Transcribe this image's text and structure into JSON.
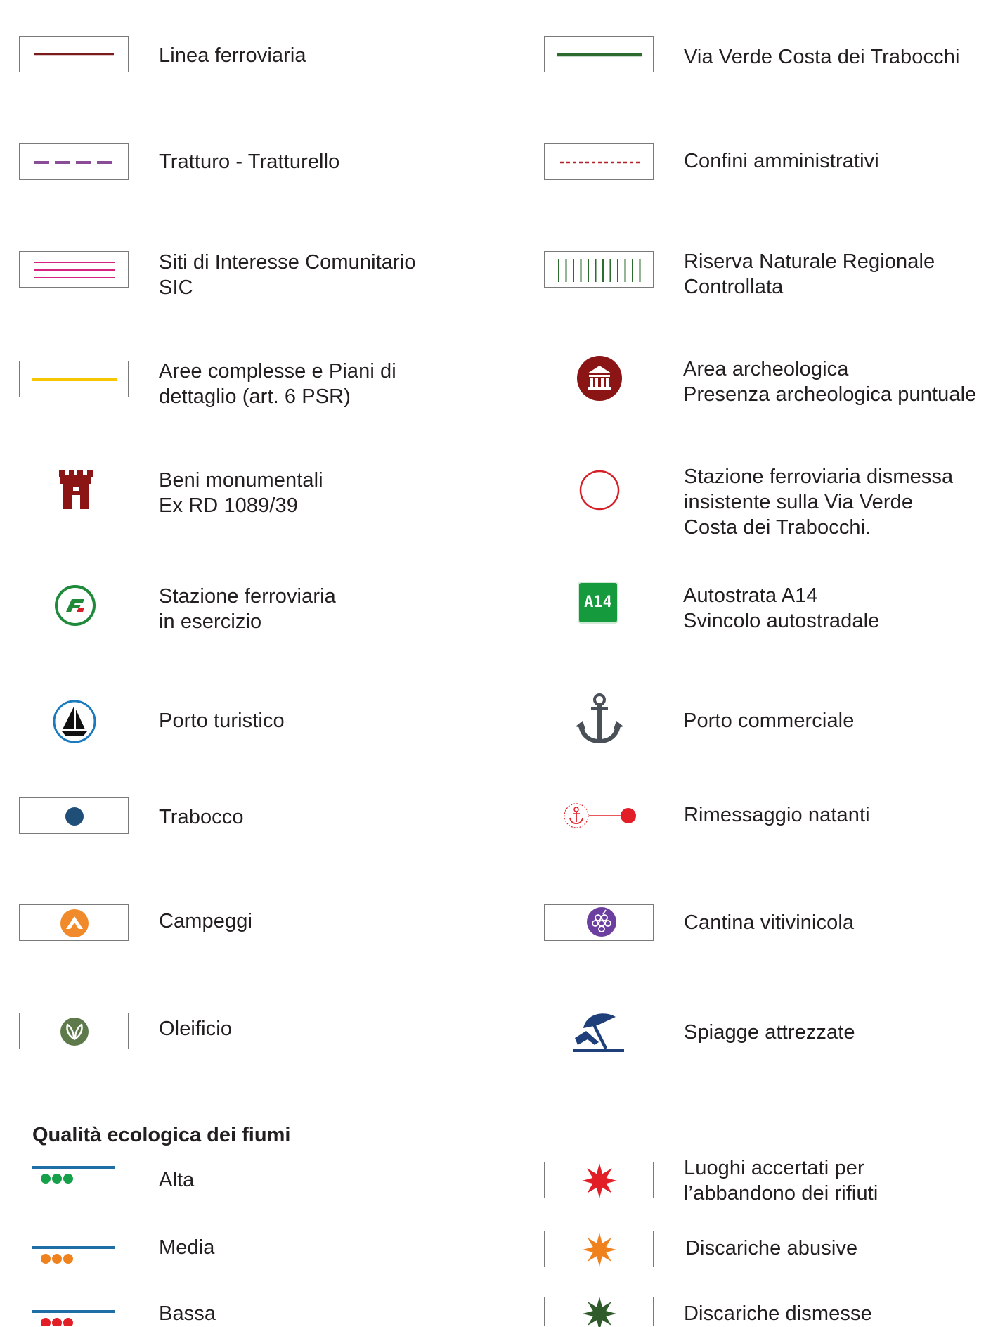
{
  "legend": [
    {
      "id": "linea",
      "lines": [
        "Linea ferroviaria"
      ]
    },
    {
      "id": "via-verde",
      "lines": [
        "Via Verde Costa dei Trabocchi"
      ]
    },
    {
      "id": "tratturo",
      "lines": [
        "Tratturo - Tratturello"
      ]
    },
    {
      "id": "confini",
      "lines": [
        "Confini amministrativi"
      ]
    },
    {
      "id": "sic",
      "lines": [
        "Siti di Interesse Comunitario",
        "SIC"
      ]
    },
    {
      "id": "riserva",
      "lines": [
        "Riserva Naturale Regionale",
        "Controllata"
      ]
    },
    {
      "id": "aree",
      "lines": [
        "Aree complesse e Piani di",
        "dettaglio (art. 6 PSR)"
      ]
    },
    {
      "id": "archeo",
      "lines": [
        "Area archeologica",
        "Presenza archeologica puntuale"
      ]
    },
    {
      "id": "beni",
      "lines": [
        "Beni monumentali",
        "Ex RD 1089/39"
      ]
    },
    {
      "id": "dismessa",
      "lines": [
        "Stazione ferroviaria dismessa",
        "insistente sulla Via Verde",
        "Costa dei Trabocchi."
      ]
    },
    {
      "id": "esercizio",
      "lines": [
        "Stazione ferroviaria",
        "in esercizio"
      ]
    },
    {
      "id": "autostrada",
      "lines": [
        "Autostrata A14",
        "Svincolo autostradale"
      ]
    },
    {
      "id": "porto-turistico",
      "lines": [
        "Porto turistico"
      ]
    },
    {
      "id": "porto-commerciale",
      "lines": [
        "Porto commerciale"
      ]
    },
    {
      "id": "trabocco",
      "lines": [
        "Trabocco"
      ]
    },
    {
      "id": "rimessaggio",
      "lines": [
        "Rimessaggio natanti"
      ]
    },
    {
      "id": "campeggi",
      "lines": [
        "Campeggi"
      ]
    },
    {
      "id": "cantina",
      "lines": [
        "Cantina vitivinicola"
      ]
    },
    {
      "id": "oleificio",
      "lines": [
        "Oleificio"
      ]
    },
    {
      "id": "spiagge",
      "lines": [
        "Spiagge attrezzate"
      ]
    },
    {
      "id": "rifiuti",
      "lines": [
        "Luoghi accertati per",
        "l’abbandono dei rifiuti"
      ]
    },
    {
      "id": "discariche-abusive",
      "lines": [
        "Discariche abusive"
      ]
    },
    {
      "id": "discariche-dismesse",
      "lines": [
        "Discariche dismesse"
      ]
    }
  ],
  "river_quality": {
    "heading": "Qualità ecologica dei fiumi",
    "levels": [
      {
        "label": "Alta"
      },
      {
        "label": "Media"
      },
      {
        "label": "Bassa"
      }
    ]
  },
  "badges": {
    "autostrada": "A14"
  },
  "colors": {
    "railway": "#7b1c1c",
    "via_verde": "#2e6b2e",
    "tratturo": "#8a4c96",
    "confini": "#b3222a",
    "sic": "#d6237d",
    "riserva": "#2e6b2e",
    "aree": "#f6c700",
    "archeo": "#8b1414",
    "beni": "#8b1414",
    "dismessa": "#d62028",
    "esercizio": "#1f8a3a",
    "autostrada": "#169a3e",
    "porto_turistico": "#1b7bbf",
    "porto_commerciale": "#4a5058",
    "trabocco": "#1f4e78",
    "rimessaggio": "#e21e26",
    "campeggi": "#f08a2a",
    "cantina": "#6b3fa0",
    "oleificio": "#5e7a4a",
    "spiagge": "#1f3f7a",
    "river": "#1f6fa6",
    "quality_high": "#15a14a",
    "quality_mid": "#f0821e",
    "quality_low": "#e21e26",
    "star_red": "#e21e26",
    "star_orange": "#f0821e",
    "star_green": "#2f5a2a"
  },
  "icons": {
    "linea": "line-solid-thin",
    "via-verde": "line-solid-thick",
    "tratturo": "line-dashed",
    "confini": "line-dotted",
    "sic": "triple-line",
    "riserva": "vertical-hatch",
    "aree": "line-yellow",
    "archeo": "temple-icon",
    "beni": "castle-tower-icon",
    "dismessa": "empty-circle-icon",
    "esercizio": "railway-logo-icon",
    "autostrada": "highway-badge-icon",
    "porto-turistico": "sailboat-icon",
    "porto-commerciale": "anchor-icon",
    "trabocco": "dot-icon",
    "rimessaggio": "anchor-line-icon",
    "campeggi": "tent-icon",
    "cantina": "grapes-icon",
    "oleificio": "leaf-icon",
    "spiagge": "beach-umbrella-icon",
    "rifiuti": "star-burst-icon",
    "discariche-abusive": "star-burst-icon",
    "discariche-dismesse": "star-burst-icon"
  }
}
